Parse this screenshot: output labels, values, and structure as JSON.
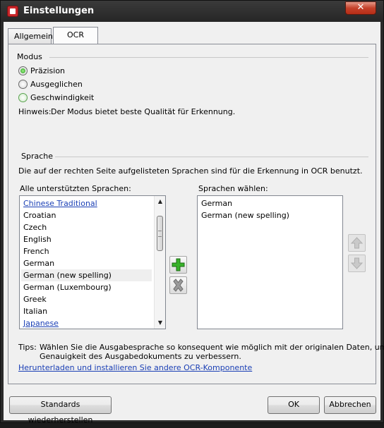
{
  "window": {
    "title": "Einstellungen",
    "close_symbol": "✕"
  },
  "tabs": [
    {
      "label": "Allgemein"
    },
    {
      "label": "OCR"
    }
  ],
  "modus": {
    "heading": "Modus",
    "options": [
      {
        "label": "Präzision",
        "selected": true
      },
      {
        "label": "Ausgeglichen",
        "selected": false
      },
      {
        "label": "Geschwindigkeit",
        "selected": false
      }
    ],
    "hint_label": "Hinweis:",
    "hint_text": "Der Modus bietet beste Qualität für Erkennung."
  },
  "sprache": {
    "heading": "Sprache",
    "description": "Die auf der rechten Seite aufgelisteten Sprachen sind für die Erkennung in OCR benutzt.",
    "all_languages_label": "Alle unterstützten Sprachen:",
    "selected_languages_label": "Sprachen wählen:",
    "all_languages": [
      "Chinese Traditional",
      "Croatian",
      "Czech",
      "English",
      "French",
      "German",
      "German (new spelling)",
      "German (Luxembourg)",
      "Greek",
      "Italian",
      "Japanese"
    ],
    "selected_languages": [
      "German",
      "German (new spelling)"
    ]
  },
  "tips": {
    "label": "Tips:",
    "line1": "Wählen Sie die Ausgabesprache so konsequent wie möglich mit der originalen Daten, um die",
    "line2": "Genauigkeit des Ausgabedokuments zu verbessern.",
    "link": "Herunterladen und installieren Sie andere OCR-Komponente"
  },
  "buttons": {
    "restore_defaults": "Standards wiederherstellen",
    "ok": "OK",
    "cancel": "Abbrechen"
  },
  "colors": {
    "accent_green": "#1f9a12",
    "link_blue": "#1a3fb5",
    "close_red": "#c5412a"
  }
}
